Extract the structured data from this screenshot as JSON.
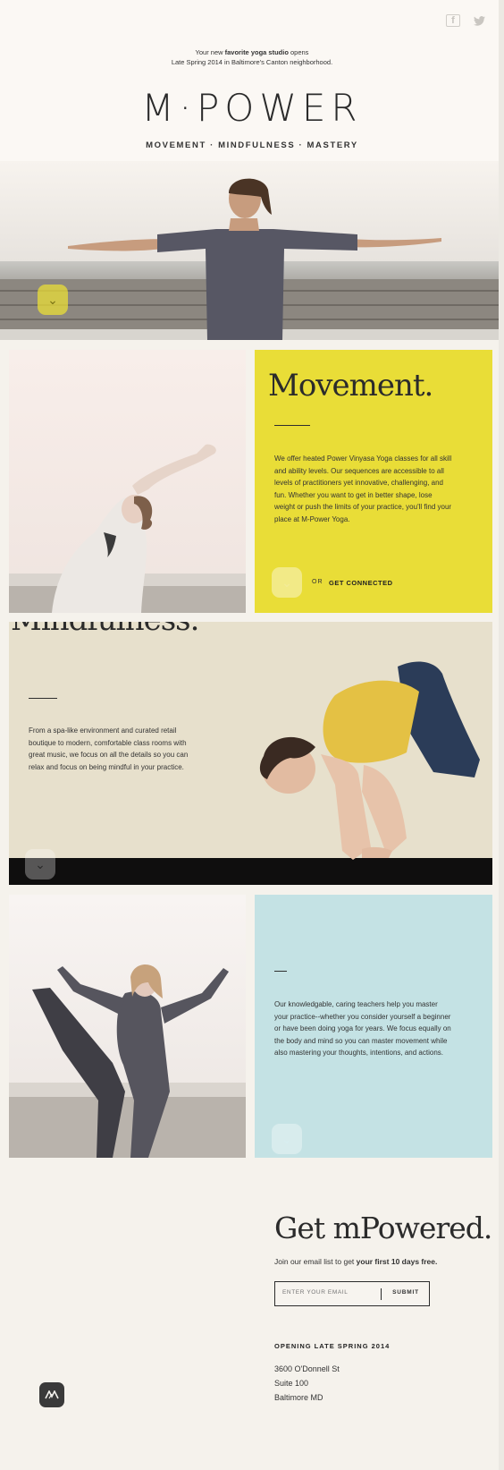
{
  "hero": {
    "tagline_pre": "Your new ",
    "tagline_bold": "favorite yoga studio",
    "tagline_post": " opens",
    "tagline_line2": "Late Spring 2014 in Baltimore's Canton neighborhood.",
    "logo": "M·POWER",
    "pillars": "MOVEMENT  ·  MINDFULNESS  ·  MASTERY",
    "social": {
      "facebook": "f",
      "twitter": "t"
    },
    "scroll_icon": "chevron-down-icon"
  },
  "movement": {
    "title": "Movement.",
    "body": "We offer heated Power Vinyasa Yoga classes for all skill and ability levels. Our sequences are accessible to all levels of practitioners yet innovative, challenging, and fun. Whether you want to get in better shape, lose weight or push the limits of your practice, you'll find your place at M-Power Yoga.",
    "or": "OR",
    "connect": "GET CONNECTED",
    "color": "#e9dd37"
  },
  "mindfulness": {
    "title": "Mindfulness.",
    "body": "From a spa-like environment and curated retail boutique to modern, comfortable class rooms with great music, we focus on all the details so you can relax and focus on being mindful in your practice.",
    "color": "#e7e0cc"
  },
  "mastery": {
    "body": "Our knowledgable, caring teachers help you master your practice--whether you consider yourself a beginner or have been doing yoga for years. We focus equally on the body and mind so you can master movement while also mastering your thoughts, intentions, and actions.",
    "color": "#c4e2e4"
  },
  "signup": {
    "title": "Get mPowered.",
    "sub_pre": "Join our email list to get ",
    "sub_bold": "your first 10 days free.",
    "placeholder": "ENTER YOUR EMAIL",
    "submit": "SUBMIT"
  },
  "info": {
    "opening": "OPENING LATE SPRING 2014",
    "address": [
      "3600 O'Donnell St",
      "Suite 100",
      "Baltimore MD"
    ]
  },
  "corner_logo": "M"
}
